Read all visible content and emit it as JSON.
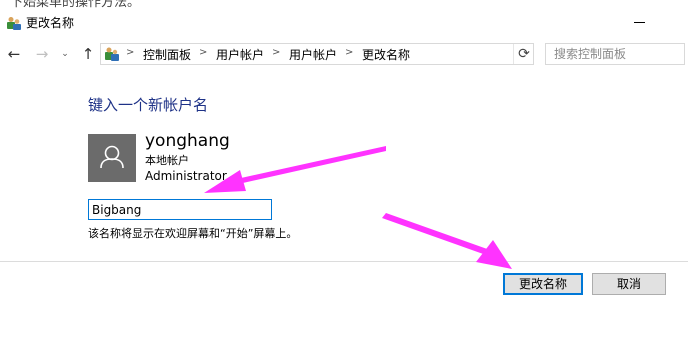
{
  "top_strip": {
    "text": "下始菜单的操作方法。"
  },
  "window": {
    "title": "更改名称"
  },
  "navigation": {
    "back_glyph": "←",
    "forward_glyph": "→",
    "dropdown_glyph": "⌄",
    "up_glyph": "↑",
    "refresh_glyph": "⟳"
  },
  "breadcrumb": [
    "控制面板",
    "用户帐户",
    "用户帐户",
    "更改名称"
  ],
  "search": {
    "placeholder": "搜索控制面板"
  },
  "main": {
    "heading": "键入一个新帐户名",
    "user": {
      "name": "yonghang",
      "account_type": "本地帐户",
      "role": "Administrator"
    },
    "name_input_value": "Bigbang",
    "hint": "该名称将显示在欢迎屏幕和“开始”屏幕上。"
  },
  "buttons": {
    "rename": "更改名称",
    "cancel": "取消"
  },
  "icons": {
    "app": "users-control-panel-icon",
    "breadcrumb": "control-panel-icon",
    "avatar": "user-avatar-icon",
    "annotations": "magenta-arrow-icon"
  },
  "colors": {
    "heading": "#1e3287",
    "accent_border": "#0078d7",
    "avatar_bg": "#6b6b6b",
    "annotation_arrow": "#ff33ff"
  }
}
